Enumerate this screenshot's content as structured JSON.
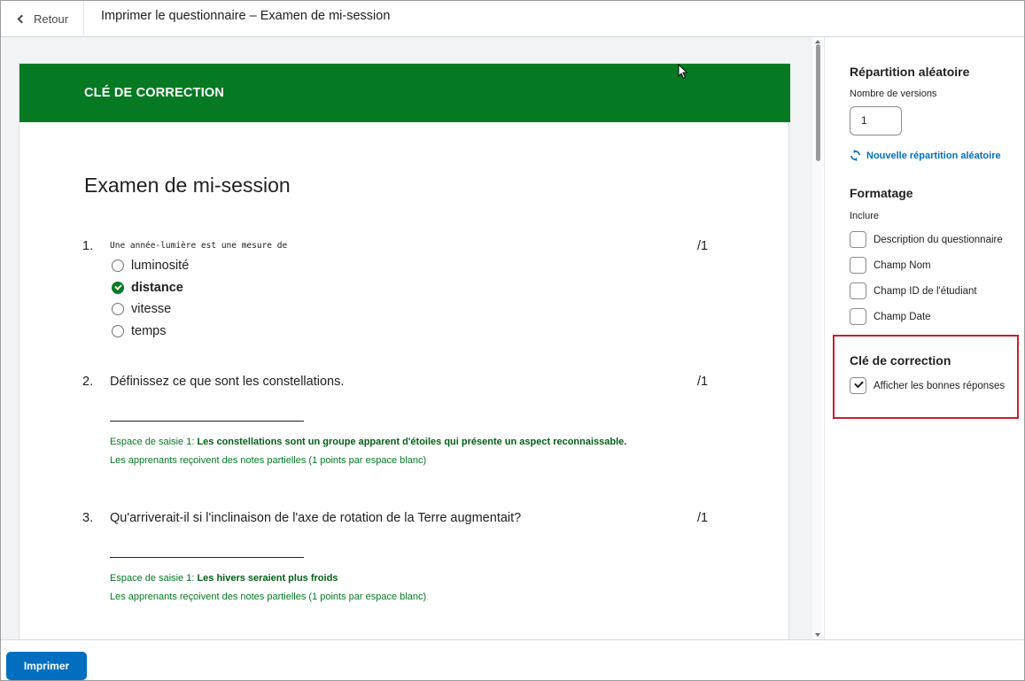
{
  "header": {
    "back_label": "Retour",
    "title": "Imprimer le questionnaire – Examen de mi-session"
  },
  "sheet": {
    "banner": "CLÉ DE CORRECTION",
    "quiz_title": "Examen de mi-session",
    "questions": [
      {
        "number": "1.",
        "text": "Une année-lumière est une mesure de",
        "points": "/1",
        "options": [
          {
            "label": "luminosité",
            "correct": false
          },
          {
            "label": "distance",
            "correct": true
          },
          {
            "label": "vitesse",
            "correct": false
          },
          {
            "label": "temps",
            "correct": false
          }
        ]
      },
      {
        "number": "2.",
        "text": "Définissez ce que sont les constellations.",
        "points": "/1",
        "answer_prefix": "Espace de saisie 1: ",
        "answer": "Les constellations sont un groupe apparent d'étoiles qui présente un aspect reconnaissable.",
        "partial_note": "Les apprenants reçoivent des notes partielles (1 points par espace blanc)"
      },
      {
        "number": "3.",
        "text": "Qu'arriverait-il si l'inclinaison de l'axe de rotation de la Terre augmentait?",
        "points": "/1",
        "answer_prefix": "Espace de saisie 1: ",
        "answer": "Les hivers seraient plus froids",
        "partial_note": "Les apprenants reçoivent des notes partielles (1 points par espace blanc)"
      }
    ]
  },
  "panel": {
    "random_heading": "Répartition aléatoire",
    "versions_label": "Nombre de versions",
    "versions_value": "1",
    "reshuffle_link": "Nouvelle répartition aléatoire",
    "format_heading": "Formatage",
    "include_label": "Inclure",
    "include_options": [
      {
        "label": "Description du questionnaire",
        "checked": false
      },
      {
        "label": "Champ Nom",
        "checked": false
      },
      {
        "label": "Champ ID de l'étudiant",
        "checked": false
      },
      {
        "label": "Champ Date",
        "checked": false
      }
    ],
    "key_heading": "Clé de correction",
    "show_answers_label": "Afficher les bonnes réponses",
    "show_answers_checked": true
  },
  "footer": {
    "print_label": "Imprimer"
  },
  "colors": {
    "banner_green": "#057a23",
    "primary_blue": "#006fbf",
    "highlight_red": "#c8202e"
  }
}
